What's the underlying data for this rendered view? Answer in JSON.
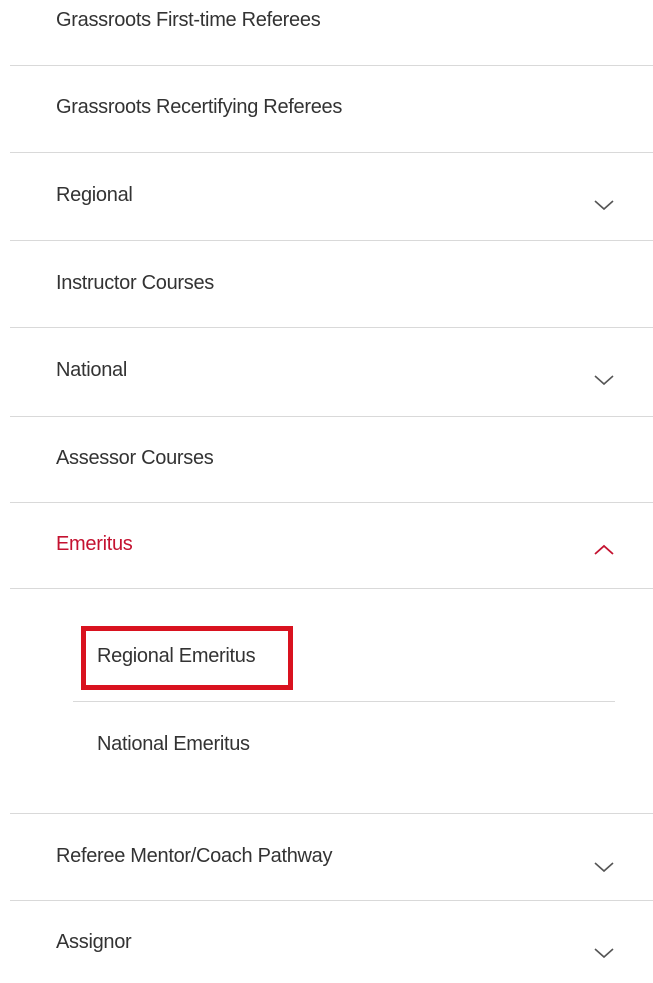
{
  "menu": {
    "items": [
      {
        "label": "Grassroots First-time Referees"
      },
      {
        "label": "Grassroots Recertifying Referees"
      },
      {
        "label": "Regional",
        "chevron": "chevron-down-icon"
      },
      {
        "label": "Instructor Courses"
      },
      {
        "label": "National",
        "chevron": "chevron-down-icon"
      },
      {
        "label": "Assessor Courses"
      },
      {
        "label": "Emeritus",
        "chevron": "chevron-up-icon",
        "expanded": true
      },
      {
        "label": "Referee Mentor/Coach Pathway",
        "chevron": "chevron-down-icon"
      },
      {
        "label": "Assignor",
        "chevron": "chevron-down-icon"
      }
    ],
    "emeritus_submenu": [
      {
        "label": "Regional Emeritus",
        "highlighted": true
      },
      {
        "label": "National Emeritus"
      }
    ]
  },
  "colors": {
    "active": "#c41230",
    "highlight_border": "#d9121f",
    "text": "#333333",
    "divider": "#d9d9d9"
  }
}
